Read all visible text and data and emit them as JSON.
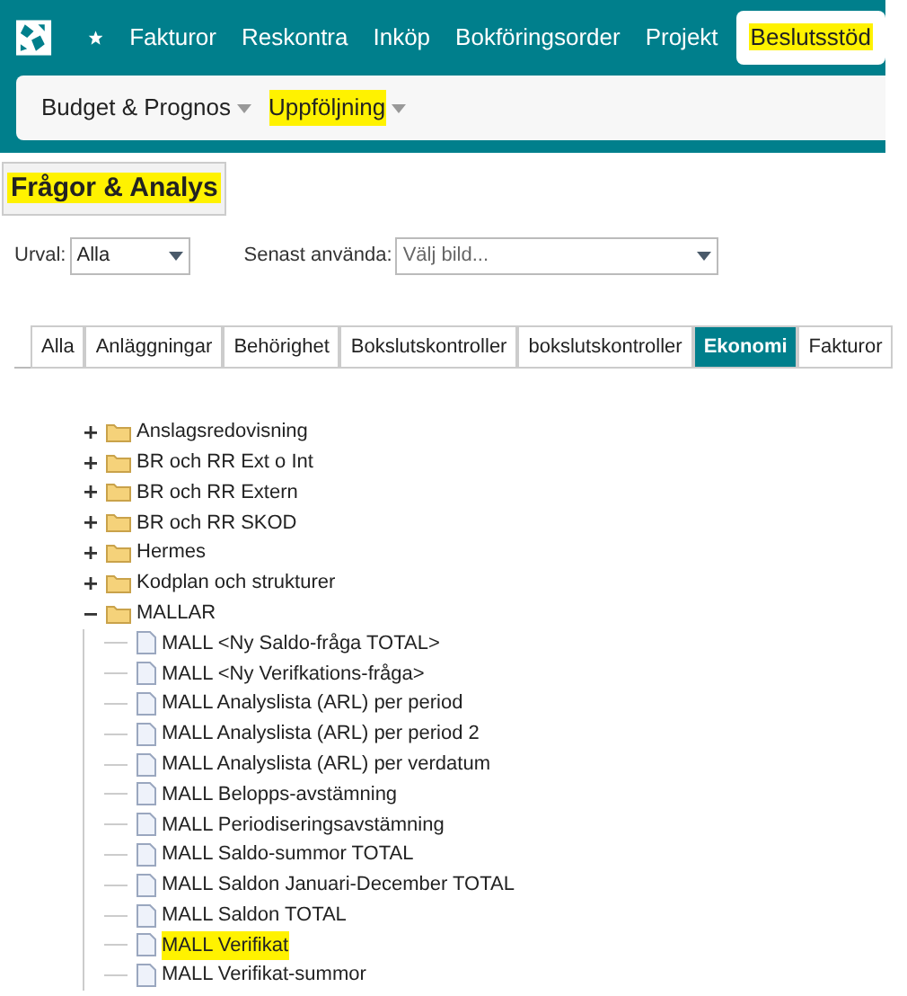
{
  "nav": {
    "items": [
      {
        "label": "Fakturor",
        "selected": false,
        "highlighted": false
      },
      {
        "label": "Reskontra",
        "selected": false,
        "highlighted": false
      },
      {
        "label": "Inköp",
        "selected": false,
        "highlighted": false
      },
      {
        "label": "Bokföringsorder",
        "selected": false,
        "highlighted": false
      },
      {
        "label": "Projekt",
        "selected": false,
        "highlighted": false
      },
      {
        "label": "Beslutsstöd",
        "selected": true,
        "highlighted": true
      }
    ]
  },
  "subnav": {
    "items": [
      {
        "label": "Budget & Prognos",
        "highlighted": false
      },
      {
        "label": "Uppföljning",
        "highlighted": true
      }
    ]
  },
  "page_title": {
    "text": "Frågor & Analys",
    "highlighted": true
  },
  "filters": [
    {
      "label": "Urval:",
      "value": "Alla",
      "placeholder": false
    },
    {
      "label": "Senast använda:",
      "value": "Välj bild...",
      "placeholder": true
    }
  ],
  "tabs": [
    {
      "label": "Alla",
      "selected": false
    },
    {
      "label": "Anläggningar",
      "selected": false
    },
    {
      "label": "Behörighet",
      "selected": false
    },
    {
      "label": "Bokslutskontroller",
      "selected": false
    },
    {
      "label": "bokslutskontroller",
      "selected": false
    },
    {
      "label": "Ekonomi",
      "selected": true
    },
    {
      "label": "Fakturor",
      "selected": false
    }
  ],
  "tree": [
    {
      "label": "Anslagsredovisning",
      "kind": "folder",
      "expanded": false,
      "highlighted": false
    },
    {
      "label": "BR och RR Ext o Int",
      "kind": "folder",
      "expanded": false,
      "highlighted": false
    },
    {
      "label": "BR och RR Extern",
      "kind": "folder",
      "expanded": false,
      "highlighted": false
    },
    {
      "label": "BR och RR SKOD",
      "kind": "folder",
      "expanded": false,
      "highlighted": false
    },
    {
      "label": "Hermes",
      "kind": "folder",
      "expanded": false,
      "highlighted": false
    },
    {
      "label": "Kodplan och strukturer",
      "kind": "folder",
      "expanded": false,
      "highlighted": false
    },
    {
      "label": "MALLAR",
      "kind": "folder",
      "expanded": true,
      "highlighted": false,
      "children": [
        {
          "label": "MALL <Ny Saldo-fråga TOTAL>",
          "kind": "file",
          "highlighted": false
        },
        {
          "label": "MALL <Ny Verifkations-fråga>",
          "kind": "file",
          "highlighted": false
        },
        {
          "label": "MALL Analyslista (ARL) per period",
          "kind": "file",
          "highlighted": false
        },
        {
          "label": "MALL Analyslista (ARL) per period 2",
          "kind": "file",
          "highlighted": false
        },
        {
          "label": "MALL Analyslista (ARL) per verdatum",
          "kind": "file",
          "highlighted": false
        },
        {
          "label": "MALL Belopps-avstämning",
          "kind": "file",
          "highlighted": false
        },
        {
          "label": "MALL Periodiseringsavstämning",
          "kind": "file",
          "highlighted": false
        },
        {
          "label": "MALL Saldo-summor TOTAL",
          "kind": "file",
          "highlighted": false
        },
        {
          "label": "MALL Saldon Januari-December TOTAL",
          "kind": "file",
          "highlighted": false
        },
        {
          "label": "MALL Saldon TOTAL",
          "kind": "file",
          "highlighted": false
        },
        {
          "label": "MALL Verifikat",
          "kind": "file",
          "highlighted": true
        },
        {
          "label": "MALL Verifikat-summor",
          "kind": "file",
          "highlighted": false
        }
      ]
    }
  ]
}
